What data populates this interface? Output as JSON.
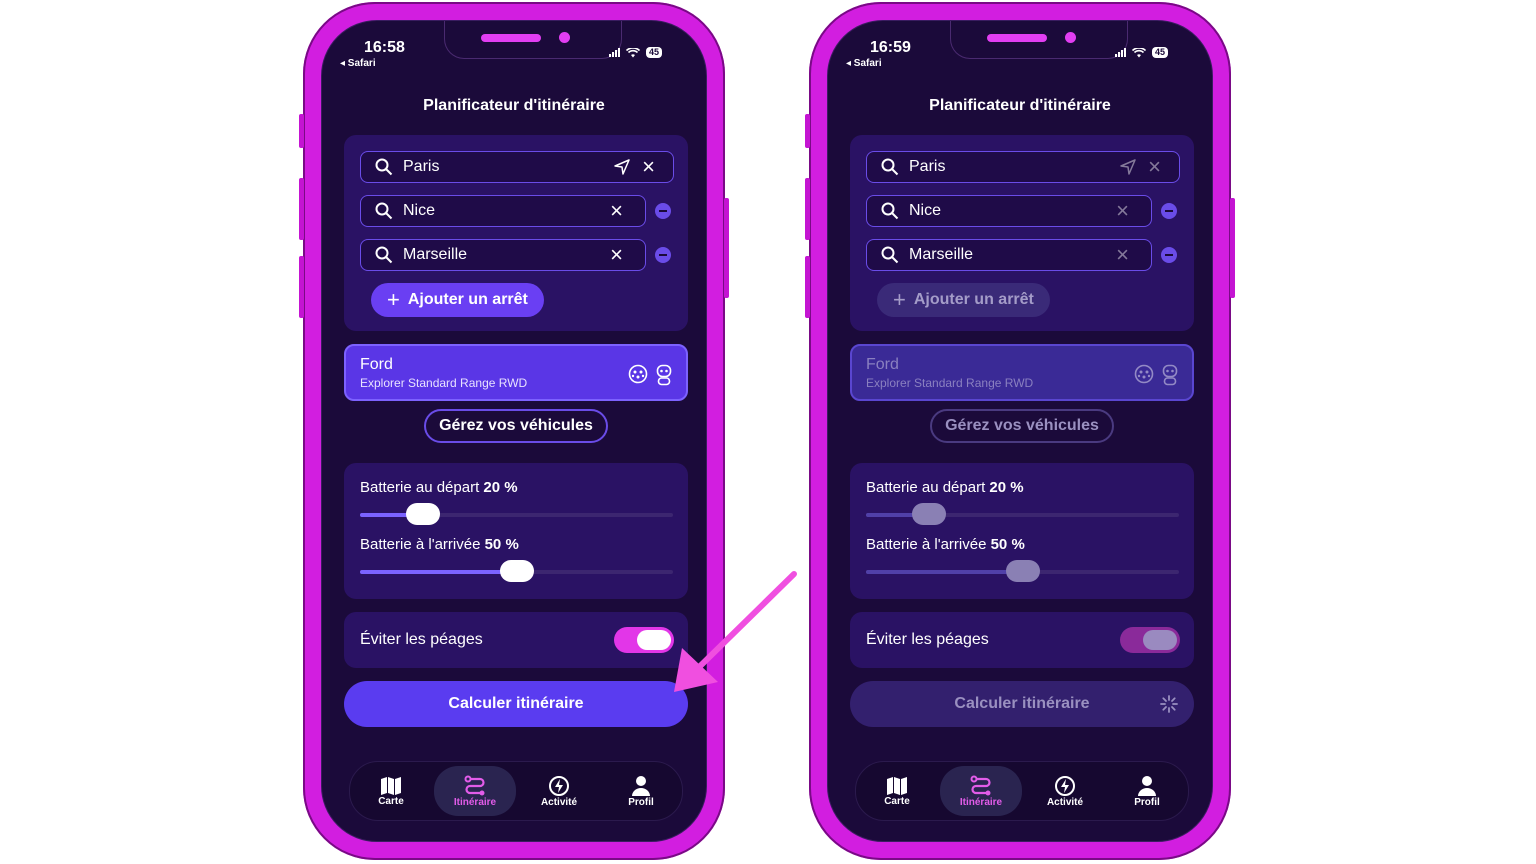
{
  "phones": [
    {
      "status_time": "16:58",
      "back_label": "◂ Safari",
      "battery": "45",
      "title": "Planificateur d'itinéraire",
      "stops": [
        "Paris",
        "Nice",
        "Marseille"
      ],
      "add_stop": "Ajouter un arrêt",
      "vehicle_brand": "Ford",
      "vehicle_model": "Explorer Standard Range RWD",
      "manage_vehicles": "Gérez vos véhicules",
      "battery_start_label": "Batterie au départ",
      "battery_start_value": "20 %",
      "battery_start_fraction": 0.2,
      "battery_end_label": "Batterie à l'arrivée",
      "battery_end_value": "50 %",
      "battery_end_fraction": 0.5,
      "avoid_tolls": "Éviter les péages",
      "calculate": "Calculer itinéraire",
      "tabs": [
        "Carte",
        "Itinéraire",
        "Activité",
        "Profil"
      ]
    },
    {
      "status_time": "16:59",
      "back_label": "◂ Safari",
      "battery": "45",
      "title": "Planificateur d'itinéraire",
      "stops": [
        "Paris",
        "Nice",
        "Marseille"
      ],
      "add_stop": "Ajouter un arrêt",
      "vehicle_brand": "Ford",
      "vehicle_model": "Explorer Standard Range RWD",
      "manage_vehicles": "Gérez vos véhicules",
      "battery_start_label": "Batterie au départ",
      "battery_start_value": "20 %",
      "battery_start_fraction": 0.2,
      "battery_end_label": "Batterie à l'arrivée",
      "battery_end_value": "50 %",
      "battery_end_fraction": 0.5,
      "avoid_tolls": "Éviter les péages",
      "calculate": "Calculer itinéraire",
      "tabs": [
        "Carte",
        "Itinéraire",
        "Activité",
        "Profil"
      ]
    }
  ],
  "colors": {
    "frame": "#d21ee0",
    "screen_bg": "#1b0a3a",
    "accent": "#5a3cf0",
    "arrow": "#f04fe0"
  }
}
